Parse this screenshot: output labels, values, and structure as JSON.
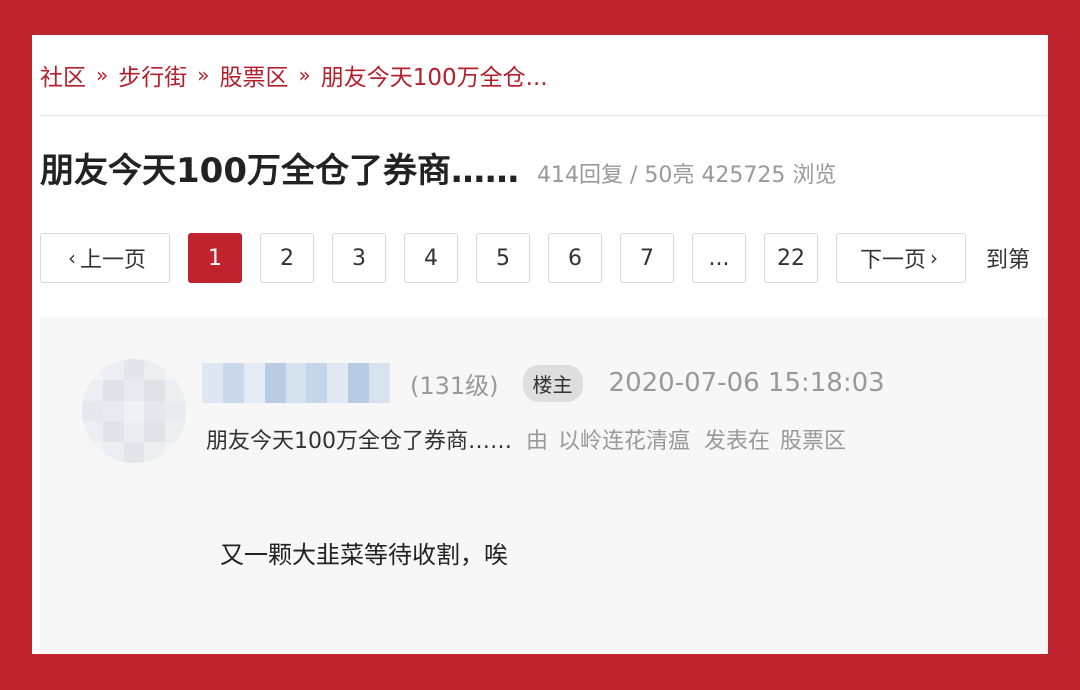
{
  "breadcrumb": {
    "items": [
      "社区",
      "步行街",
      "股票区",
      "朋友今天100万全仓..."
    ],
    "separator": "»"
  },
  "thread": {
    "title": "朋友今天100万全仓了券商……",
    "stats": "414回复 / 50亮 425725 浏览"
  },
  "pager": {
    "prev_label": "上一页",
    "next_label": "下一页",
    "pages": [
      "1",
      "2",
      "3",
      "4",
      "5",
      "6",
      "7",
      "...",
      "22"
    ],
    "active_page": "1",
    "goto_label": "到第"
  },
  "post": {
    "level": "(131级)",
    "badge": "楼主",
    "date": "2020-07-06 15:18:03",
    "subject": "朋友今天100万全仓了券商……",
    "by_label": "由",
    "author": "以岭连花清瘟",
    "posted_in_label": "发表在",
    "board": "股票区",
    "content": "又一颗大韭菜等待收割，唉"
  },
  "colors": {
    "accent": "#c0222e",
    "link": "#b3202c",
    "muted": "#999999",
    "post_bg": "#f7f7f7"
  }
}
